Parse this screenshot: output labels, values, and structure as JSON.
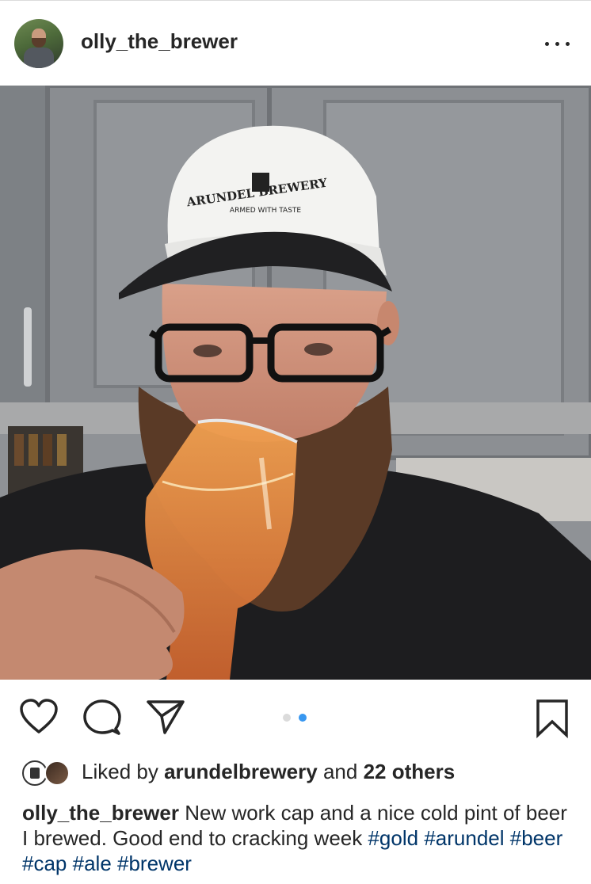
{
  "post": {
    "username": "olly_the_brewer",
    "more_label": "More options",
    "photo_alt": "Selfie of a bearded man in an Arundel Brewery cap drinking beer",
    "cap_text_top": "ARUNDEL BREWERY",
    "cap_text_bottom": "ARMED WITH TASTE"
  },
  "actions": {
    "like_icon": "heart-icon",
    "comment_icon": "comment-icon",
    "share_icon": "paper-plane-icon",
    "save_icon": "bookmark-icon",
    "carousel_total": 2,
    "carousel_active_index": 2
  },
  "likes": {
    "prefix": "Liked by",
    "user": "arundelbrewery",
    "middle": "and",
    "others": "22 others"
  },
  "caption": {
    "author": "olly_the_brewer",
    "text": " New work cap and a nice cold pint of beer I brewed. Good end to cracking week ",
    "hashtags": [
      "#gold",
      "#arundel",
      "#beer",
      "#cap",
      "#ale",
      "#brewer"
    ]
  },
  "colors": {
    "text": "#262626",
    "hashtag": "#003569",
    "carousel_active": "#3897f0",
    "carousel_inactive": "#dbdbdb"
  }
}
